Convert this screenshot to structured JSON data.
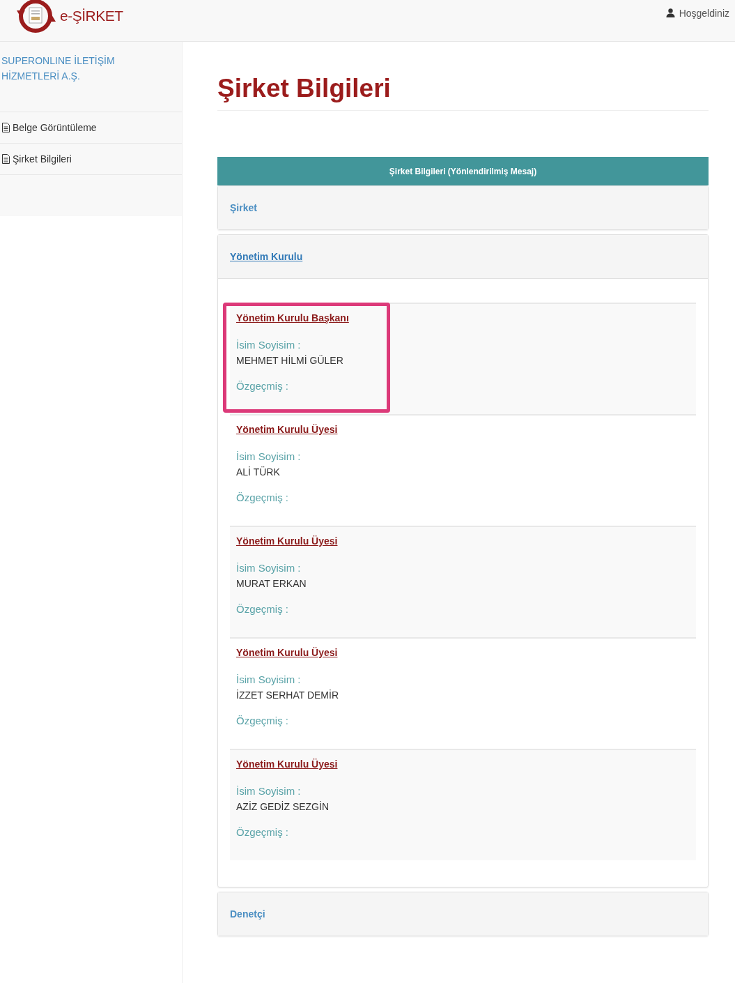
{
  "header": {
    "logo_text": "e-ŞİRKET",
    "greeting": "Hoşgeldiniz"
  },
  "sidebar": {
    "company": "SUPERONLINE İLETİŞİM HİZMETLERİ A.Ş.",
    "items": [
      {
        "label": "Belge Görüntüleme"
      },
      {
        "label": "Şirket Bilgileri"
      }
    ]
  },
  "page_title": "Şirket Bilgileri",
  "panel_heading": "Şirket Bilgileri (Yönlendirilmiş Mesaj)",
  "sections": [
    {
      "title": "Şirket",
      "expanded": false
    },
    {
      "title": "Yönetim Kurulu",
      "expanded": true,
      "members": [
        {
          "role": "Yönetim Kurulu Başkanı",
          "name_label": "İsim Soyisim :",
          "name": "MEHMET HİLMİ GÜLER",
          "cv_label": "Özgeçmiş :",
          "highlighted": true
        },
        {
          "role": "Yönetim Kurulu Üyesi",
          "name_label": "İsim Soyisim :",
          "name": "ALİ TÜRK",
          "cv_label": "Özgeçmiş :",
          "highlighted": false
        },
        {
          "role": "Yönetim Kurulu Üyesi",
          "name_label": "İsim Soyisim :",
          "name": "MURAT ERKAN",
          "cv_label": "Özgeçmiş :",
          "highlighted": false
        },
        {
          "role": "Yönetim Kurulu Üyesi",
          "name_label": "İsim Soyisim :",
          "name": "İZZET SERHAT DEMİR",
          "cv_label": "Özgeçmiş :",
          "highlighted": false
        },
        {
          "role": "Yönetim Kurulu Üyesi",
          "name_label": "İsim Soyisim :",
          "name": "AZİZ GEDİZ SEZGİN",
          "cv_label": "Özgeçmiş :",
          "highlighted": false
        }
      ]
    },
    {
      "title": "Denetçi",
      "expanded": false
    }
  ]
}
